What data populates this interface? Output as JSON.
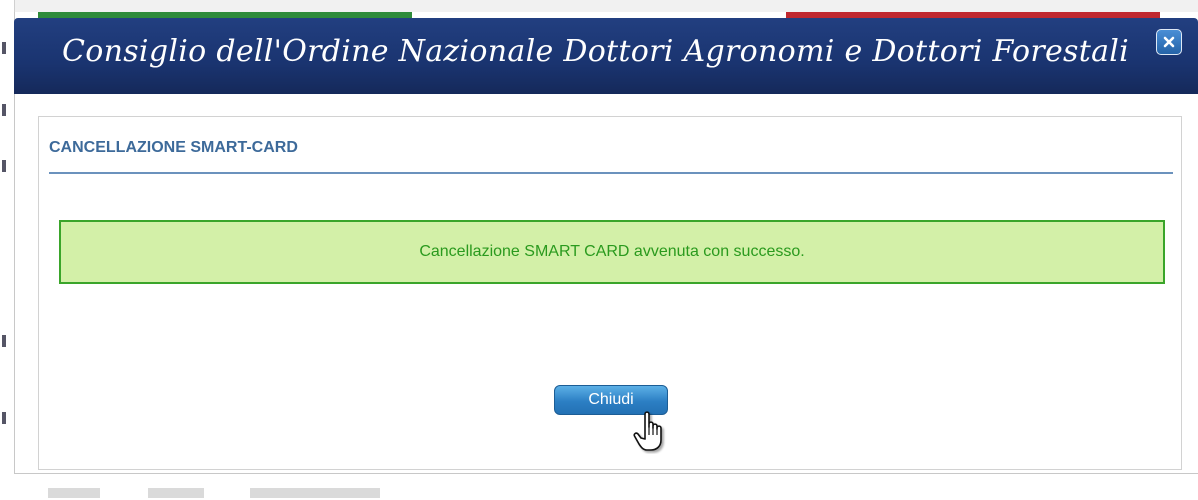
{
  "dialog": {
    "title": "Consiglio dell'Ordine Nazionale Dottori Agronomi e Dottori Forestali",
    "close_icon": "close-icon",
    "flag_colors": [
      "#2e8b3a",
      "#ffffff",
      "#c0282f"
    ]
  },
  "panel": {
    "heading": "CANCELLAZIONE SMART-CARD",
    "message": "Cancellazione SMART CARD avvenuta con successo.",
    "close_button_label": "Chiudi"
  },
  "colors": {
    "titlebar": "#1a3470",
    "heading": "#3d6a9a",
    "success_bg": "#d3f0a8",
    "success_border": "#3aa52a",
    "button": "#2c7fc4"
  },
  "cursor_icon": "hand-pointer-icon"
}
